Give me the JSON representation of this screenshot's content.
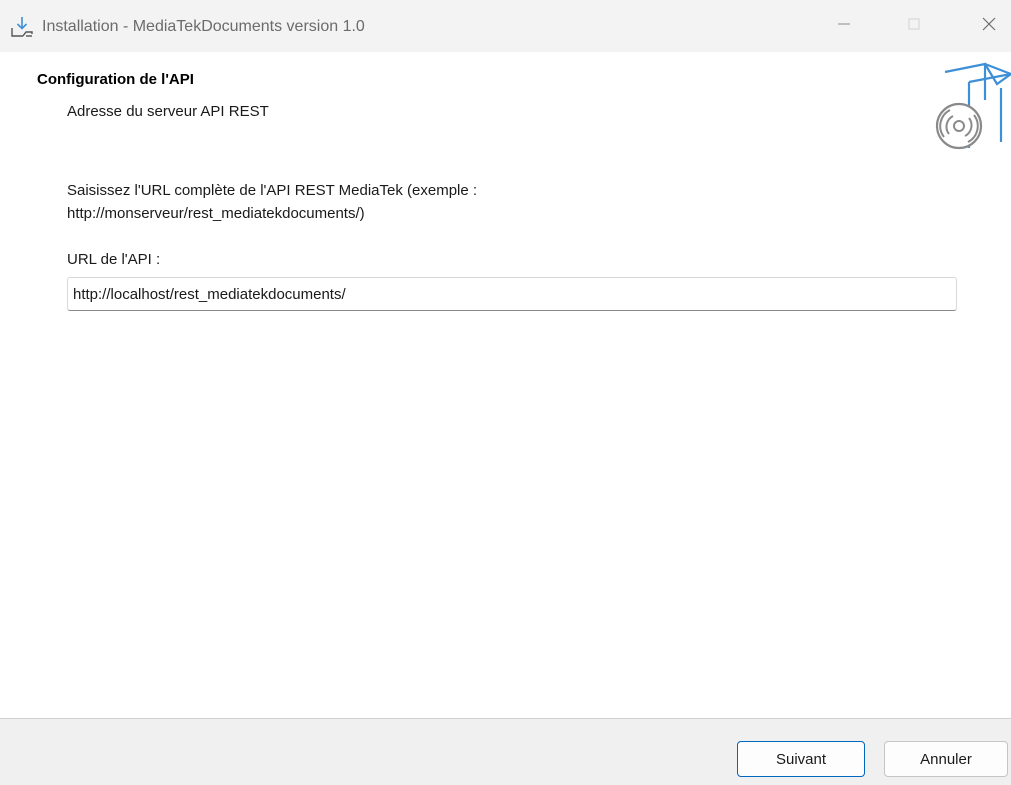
{
  "window": {
    "title": "Installation - MediaTekDocuments version 1.0",
    "icons": {
      "app": "download-install-icon",
      "minimize": "minimize-icon",
      "maximize": "maximize-icon",
      "close": "close-icon"
    }
  },
  "header": {
    "title": "Configuration de l'API",
    "subtitle": "Adresse du serveur API REST",
    "image": "software-box-cd-icon"
  },
  "body": {
    "instructions_line1": "Saisissez l'URL complète de l'API REST MediaTek (exemple :",
    "instructions_line2": "http://monserveur/rest_mediatekdocuments/)",
    "url_label": "URL de l'API :",
    "url_value": "http://localhost/rest_mediatekdocuments/"
  },
  "footer": {
    "next_label": "Suivant",
    "cancel_label": "Annuler"
  },
  "colors": {
    "accent": "#0067c0",
    "titlebar_bg": "#f3f3f3",
    "footer_bg": "#f0f0f0",
    "icon_blue": "#3f8fd6"
  }
}
